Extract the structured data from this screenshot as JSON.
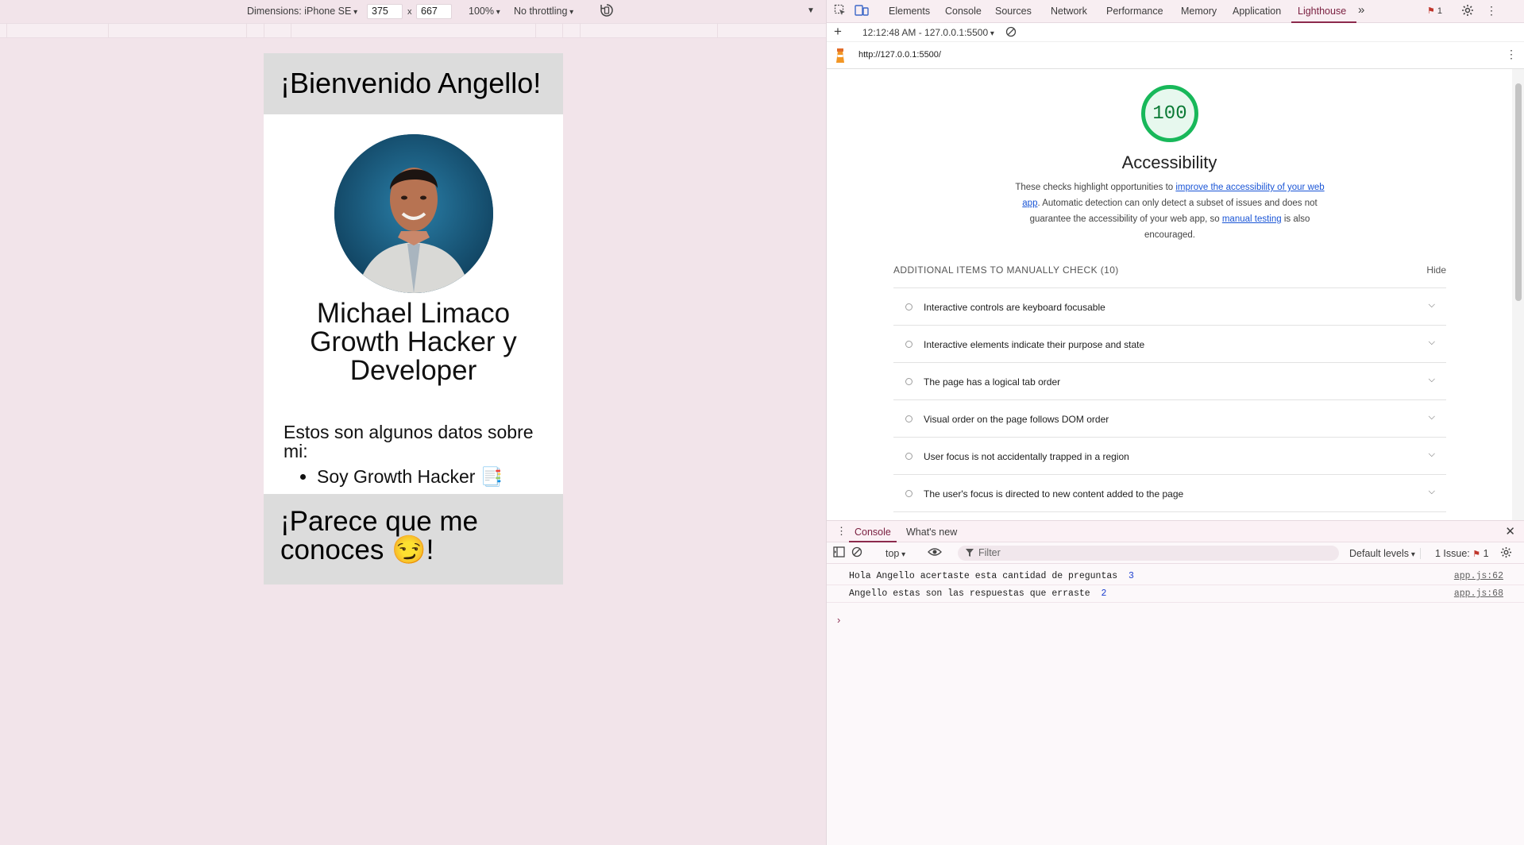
{
  "device_toolbar": {
    "dimensions_label": "Dimensions: iPhone SE",
    "width_value": "375",
    "times_sign": "x",
    "height_value": "667",
    "zoom": "100%",
    "throttling": "No throttling"
  },
  "phone": {
    "greeting": "¡Bienvenido Angello!",
    "name_lines": [
      "Michael Limaco",
      "Growth Hacker y",
      "Developer"
    ],
    "facts_intro": "Estos son algunos datos sobre mi:",
    "facts_items": [
      "Soy Growth Hacker 📑"
    ],
    "footer_text": "¡Parece que me conoces 😏!"
  },
  "devtools": {
    "tabs": [
      "Elements",
      "Console",
      "Sources",
      "Network",
      "Performance",
      "Memory",
      "Application",
      "Lighthouse"
    ],
    "active_tab": "Lighthouse",
    "issues_count": "1",
    "report_selector": "12:12:48 AM - 127.0.0.1:5500",
    "url": "http://127.0.0.1:5500/"
  },
  "lighthouse": {
    "score": "100",
    "category": "Accessibility",
    "desc_before": "These checks highlight opportunities to ",
    "desc_link1": "improve the accessibility of your web app",
    "desc_middle": ". Automatic detection can only detect a subset of issues and does not guarantee the accessibility of your web app, so ",
    "desc_link2": "manual testing",
    "desc_after": " is also encouraged.",
    "group_title": "ADDITIONAL ITEMS TO MANUALLY CHECK (10)",
    "hide_label": "Hide",
    "audits": [
      "Interactive controls are keyboard focusable",
      "Interactive elements indicate their purpose and state",
      "The page has a logical tab order",
      "Visual order on the page follows DOM order",
      "User focus is not accidentally trapped in a region",
      "The user's focus is directed to new content added to the page"
    ],
    "score_color": "#18b85a"
  },
  "drawer": {
    "tabs": [
      "Console",
      "What's new"
    ],
    "context": "top",
    "filter_placeholder": "Filter",
    "levels": "Default levels",
    "issues_label": "1 Issue:",
    "issues_count": "1",
    "logs": [
      {
        "text": "Hola Angello acertaste esta cantidad de preguntas",
        "value": "3",
        "source": "app.js:62"
      },
      {
        "text": "Angello estas son las respuestas que erraste",
        "value": "2",
        "source": "app.js:68"
      }
    ]
  }
}
